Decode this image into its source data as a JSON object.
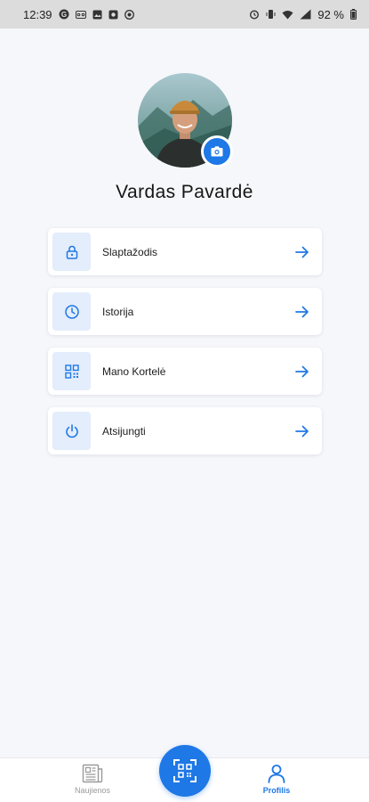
{
  "status_bar": {
    "time": "12:39",
    "battery_percent": "92 %",
    "left_icons": [
      "app-g-icon",
      "voicemail-icon",
      "photo-icon",
      "android-icon",
      "cast-icon"
    ],
    "right_icons": [
      "alarm-icon",
      "vibrate-icon",
      "wifi-icon",
      "signal-icon",
      "battery-icon"
    ]
  },
  "profile": {
    "name": "Vardas Pavardė"
  },
  "menu": {
    "items": [
      {
        "label": "Slaptažodis",
        "icon": "lock-icon"
      },
      {
        "label": "Istorija",
        "icon": "clock-icon"
      },
      {
        "label": "Mano Kortelė",
        "icon": "qr-code-icon"
      },
      {
        "label": "Atsijungti",
        "icon": "power-icon"
      }
    ]
  },
  "bottom_nav": {
    "news_label": "Naujienos",
    "profile_label": "Profilis",
    "active": "Profilis"
  },
  "colors": {
    "accent": "#1e78e6",
    "icon_bg": "#e3edfb",
    "background": "#f6f7fb"
  }
}
